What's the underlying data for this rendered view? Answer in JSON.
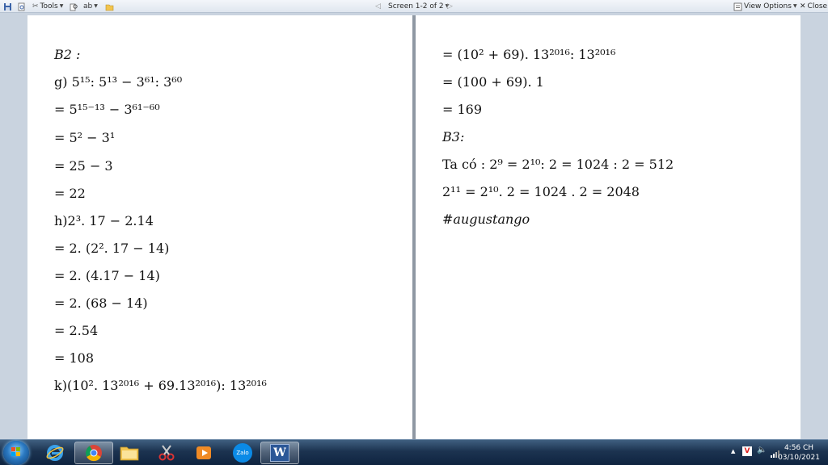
{
  "toolbar": {
    "tools_label": "Tools",
    "screen_label": "Screen 1-2 of 2",
    "view_options_label": "View Options",
    "close_label": "Close"
  },
  "document": {
    "left_page": {
      "b2_label": "B2 :",
      "g_problem": "g) 5¹⁵: 5¹³ − 3⁶¹: 3⁶⁰",
      "g_step1": "= 5¹⁵⁻¹³ − 3⁶¹⁻⁶⁰",
      "g_step2": "= 5² − 3¹",
      "g_step3": "= 25 − 3",
      "g_step4": "= 22",
      "h_problem": "h)2³. 17 − 2.14",
      "h_step1": "= 2. (2². 17 − 14)",
      "h_step2": "= 2. (4.17 − 14)",
      "h_step3": "= 2. (68 − 14)",
      "h_step4": "= 2.54",
      "h_step5": "= 108",
      "k_problem": "k)(10². 13²⁰¹⁶ + 69.13²⁰¹⁶): 13²⁰¹⁶"
    },
    "right_page": {
      "k_step1": "= (10² + 69). 13²⁰¹⁶: 13²⁰¹⁶",
      "k_step2": "= (100 + 69). 1",
      "k_step3": "= 169",
      "b3_label": "B3:",
      "b3_line1": "Ta có : 2⁹ = 2¹⁰: 2 = 1024 : 2 = 512",
      "b3_line2": "2¹¹ = 2¹⁰. 2 = 1024 . 2 = 2048",
      "hashtag": "#augustango"
    }
  },
  "taskbar": {
    "apps": [
      "start-button",
      "internet-explorer-icon",
      "chrome-icon",
      "file-explorer-icon",
      "snipping-tool-icon",
      "media-player-icon",
      "zalo-icon",
      "word-icon"
    ],
    "zalo_label": "Zalo",
    "word_label": "W",
    "clock_time": "4:56 CH",
    "clock_date": "03/10/2021"
  },
  "colors": {
    "taskbar": "#1c3350",
    "background": "#c9d3df",
    "page": "#ffffff",
    "word_blue": "#2b5797"
  }
}
